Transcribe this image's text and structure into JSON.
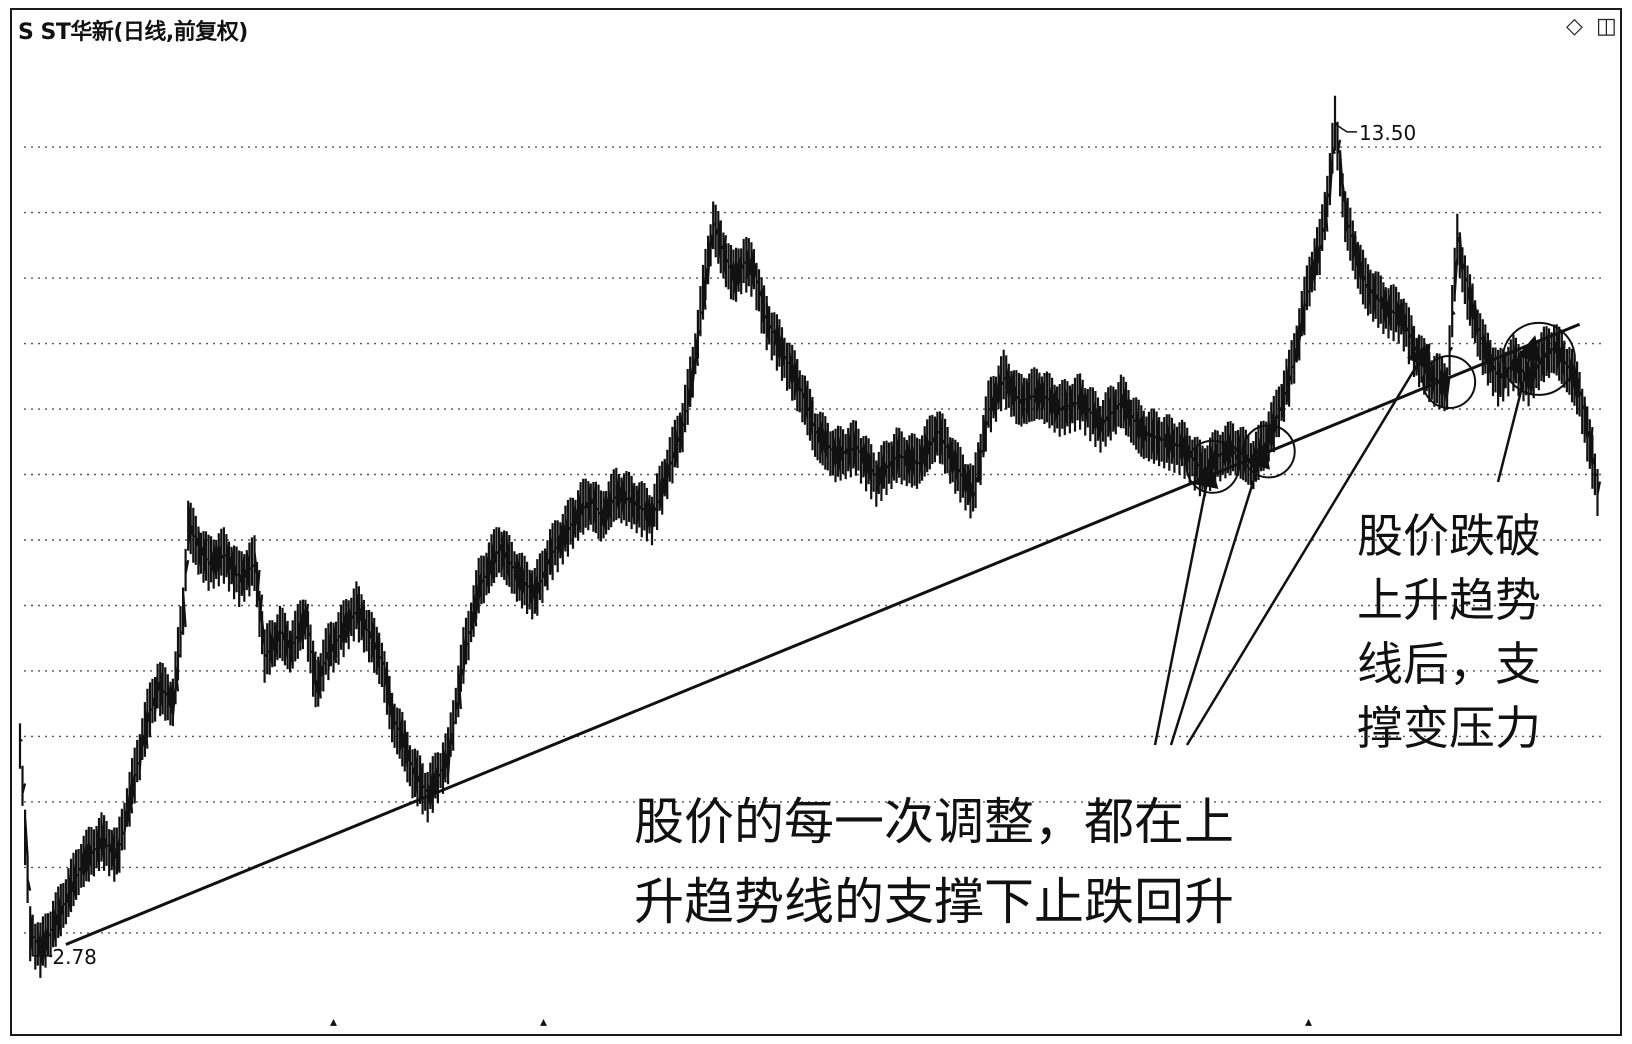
{
  "chart_data": {
    "type": "line",
    "title": "S ST华新(日线,前复权)",
    "ylim": [
      2.0,
      14.2
    ],
    "price_high_label": "13.50",
    "price_low_label": "2.78",
    "high": 13.5,
    "low": 2.78,
    "series": [
      {
        "x": [
          0,
          10,
          20,
          40,
          60,
          80,
          95,
          100,
          115,
          125,
          135,
          150,
          160,
          165,
          175,
          185,
          200,
          215,
          230,
          240,
          250,
          255,
          265,
          280,
          290,
          300,
          315,
          330,
          345,
          355,
          365,
          375,
          385,
          400,
          420,
          435,
          450,
          470,
          490,
          505,
          520,
          535,
          550,
          560,
          570,
          585,
          600,
          620,
          640,
          650,
          660,
          670,
          680,
          690,
          700,
          710,
          720,
          730,
          745,
          760,
          770,
          780,
          800,
          820,
          840,
          860,
          880,
          900,
          920,
          935,
          950,
          965,
          980,
          1000,
          1020,
          1040,
          1060,
          1080,
          1100,
          1120,
          1140,
          1160,
          1175,
          1190,
          1210,
          1230,
          1245,
          1255,
          1265,
          1275,
          1285,
          1290,
          1300,
          1310,
          1320,
          1340,
          1355,
          1370,
          1385,
          1400,
          1410,
          1420,
          1435,
          1450,
          1465,
          1480,
          1495,
          1505,
          1520,
          1530,
          1540,
          1550
        ],
        "y": [
          5.5,
          3.0,
          2.78,
          3.3,
          3.9,
          4.2,
          4.0,
          4.3,
          5.2,
          5.8,
          6.2,
          6.0,
          7.2,
          8.3,
          8.0,
          7.8,
          7.9,
          7.6,
          7.8,
          6.6,
          6.8,
          6.9,
          6.7,
          7.1,
          6.2,
          6.6,
          6.9,
          7.2,
          6.8,
          6.5,
          5.8,
          5.5,
          5.1,
          4.8,
          5.3,
          6.6,
          7.5,
          8.0,
          7.6,
          7.4,
          7.9,
          8.2,
          8.5,
          8.6,
          8.4,
          8.7,
          8.6,
          8.4,
          9.2,
          9.6,
          10.3,
          11.3,
          12.2,
          11.8,
          11.5,
          11.7,
          11.6,
          11.0,
          10.6,
          10.2,
          9.9,
          9.5,
          9.2,
          9.3,
          8.9,
          9.2,
          9.1,
          9.5,
          9.0,
          8.7,
          9.8,
          10.2,
          9.9,
          10.0,
          9.8,
          9.9,
          9.6,
          9.9,
          9.5,
          9.4,
          9.3,
          9.0,
          9.2,
          9.3,
          9.1,
          9.6,
          10.2,
          10.8,
          11.5,
          11.9,
          12.8,
          13.5,
          12.3,
          11.8,
          11.4,
          11.1,
          11.0,
          10.5,
          10.2,
          10.1,
          12.0,
          11.3,
          10.6,
          10.2,
          10.4,
          10.2,
          10.5,
          10.6,
          10.3,
          10.0,
          9.3,
          8.6
        ]
      }
    ],
    "trendline": {
      "x": [
        45,
        1530
      ],
      "y": [
        2.85,
        10.9
      ]
    },
    "markers": [
      {
        "label": "圈1",
        "x": 1170,
        "y": 9.05
      },
      {
        "label": "圈2",
        "x": 1225,
        "y": 9.25
      },
      {
        "label": "圈3",
        "x": 1402,
        "y": 10.15
      },
      {
        "label": "圈4",
        "x": 1490,
        "y": 10.45
      }
    ],
    "grid": "horizontal-dotted",
    "annotations": [
      "股价的每一次调整，都在上\n升趋势线的支撑下止跌回升",
      "股价跌破\n上升趋势\n线后，支\n撑变压力"
    ]
  },
  "toolbar": {
    "diamond_icon": "◇",
    "panel_icon": "◫"
  }
}
